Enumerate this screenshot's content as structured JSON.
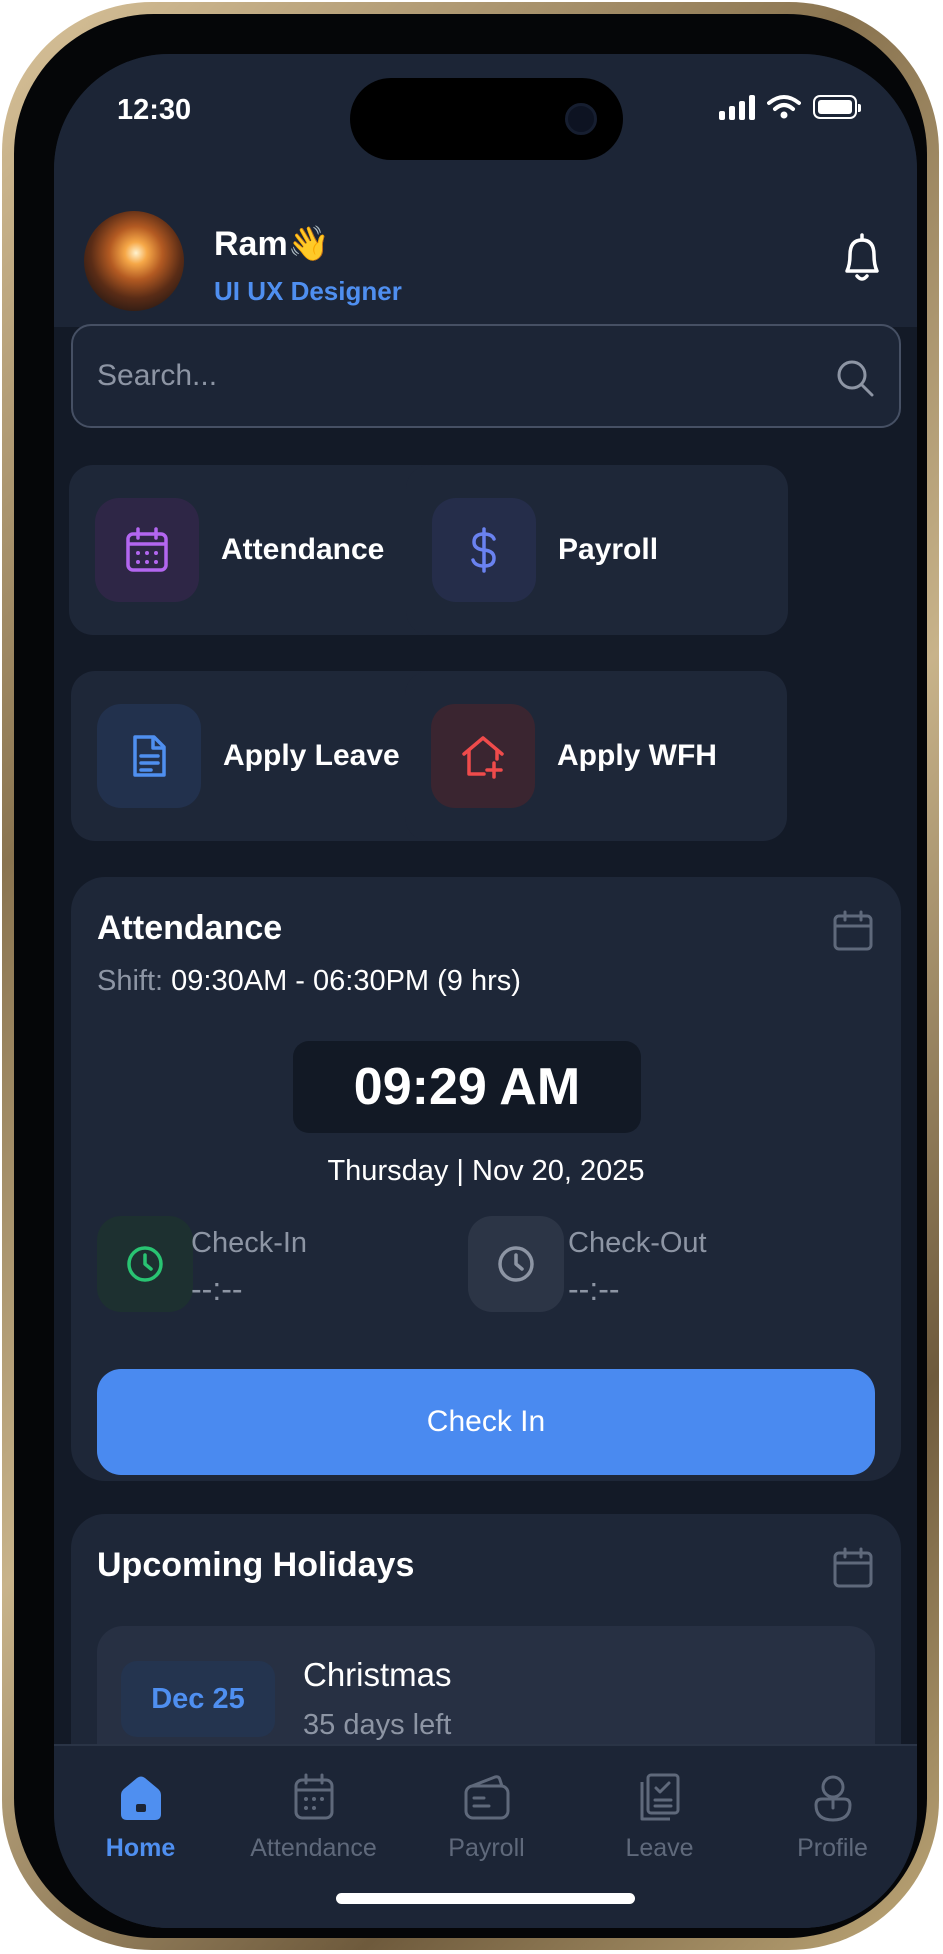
{
  "status_bar": {
    "time": "12:30"
  },
  "header": {
    "user_name": "Ram👋",
    "user_role": "UI UX Designer"
  },
  "search": {
    "placeholder": "Search..."
  },
  "quick_actions": [
    {
      "label": "Attendance",
      "icon": "calendar-icon",
      "color": "#b366f0"
    },
    {
      "label": "Payroll",
      "icon": "dollar-icon",
      "color": "#6a82f0"
    },
    {
      "label": "Apply Leave",
      "icon": "document-icon",
      "color": "#4f8ff0"
    },
    {
      "label": "Apply WFH",
      "icon": "house-plus-icon",
      "color": "#ef4b4b"
    }
  ],
  "attendance_card": {
    "title": "Attendance",
    "shift_label": "Shift:",
    "shift_value": "09:30AM - 06:30PM (9 hrs)",
    "time": "09:29 AM",
    "date": "Thursday | Nov 20, 2025",
    "check_in_label": "Check-In",
    "check_in_value": "--:--",
    "check_out_label": "Check-Out",
    "check_out_value": "--:--",
    "button_label": "Check In"
  },
  "holidays": {
    "title": "Upcoming Holidays",
    "items": [
      {
        "date": "Dec 25",
        "name": "Christmas",
        "days_left": "35 days left"
      }
    ]
  },
  "bottom_nav": {
    "items": [
      {
        "label": "Home",
        "active": true
      },
      {
        "label": "Attendance",
        "active": false
      },
      {
        "label": "Payroll",
        "active": false
      },
      {
        "label": "Leave",
        "active": false
      },
      {
        "label": "Profile",
        "active": false
      }
    ]
  },
  "colors": {
    "accent": "#4a8af0",
    "background": "#131a27",
    "card": "#1e2738",
    "check_in_green": "#29c472",
    "frame_gold": "#c8b38a"
  }
}
